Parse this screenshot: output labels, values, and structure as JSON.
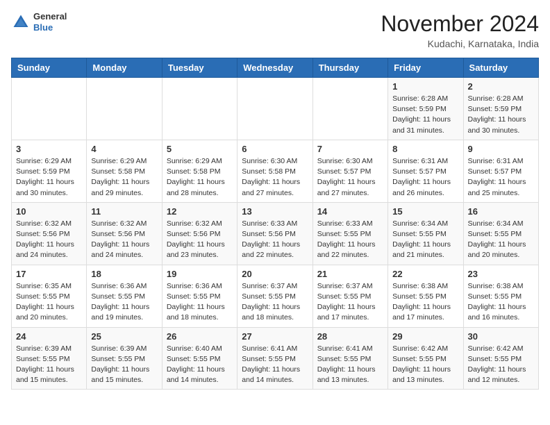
{
  "header": {
    "logo_general": "General",
    "logo_blue": "Blue",
    "month_year": "November 2024",
    "location": "Kudachi, Karnataka, India"
  },
  "calendar": {
    "days_of_week": [
      "Sunday",
      "Monday",
      "Tuesday",
      "Wednesday",
      "Thursday",
      "Friday",
      "Saturday"
    ],
    "weeks": [
      [
        {
          "day": "",
          "info": ""
        },
        {
          "day": "",
          "info": ""
        },
        {
          "day": "",
          "info": ""
        },
        {
          "day": "",
          "info": ""
        },
        {
          "day": "",
          "info": ""
        },
        {
          "day": "1",
          "info": "Sunrise: 6:28 AM\nSunset: 5:59 PM\nDaylight: 11 hours\nand 31 minutes."
        },
        {
          "day": "2",
          "info": "Sunrise: 6:28 AM\nSunset: 5:59 PM\nDaylight: 11 hours\nand 30 minutes."
        }
      ],
      [
        {
          "day": "3",
          "info": "Sunrise: 6:29 AM\nSunset: 5:59 PM\nDaylight: 11 hours\nand 30 minutes."
        },
        {
          "day": "4",
          "info": "Sunrise: 6:29 AM\nSunset: 5:58 PM\nDaylight: 11 hours\nand 29 minutes."
        },
        {
          "day": "5",
          "info": "Sunrise: 6:29 AM\nSunset: 5:58 PM\nDaylight: 11 hours\nand 28 minutes."
        },
        {
          "day": "6",
          "info": "Sunrise: 6:30 AM\nSunset: 5:58 PM\nDaylight: 11 hours\nand 27 minutes."
        },
        {
          "day": "7",
          "info": "Sunrise: 6:30 AM\nSunset: 5:57 PM\nDaylight: 11 hours\nand 27 minutes."
        },
        {
          "day": "8",
          "info": "Sunrise: 6:31 AM\nSunset: 5:57 PM\nDaylight: 11 hours\nand 26 minutes."
        },
        {
          "day": "9",
          "info": "Sunrise: 6:31 AM\nSunset: 5:57 PM\nDaylight: 11 hours\nand 25 minutes."
        }
      ],
      [
        {
          "day": "10",
          "info": "Sunrise: 6:32 AM\nSunset: 5:56 PM\nDaylight: 11 hours\nand 24 minutes."
        },
        {
          "day": "11",
          "info": "Sunrise: 6:32 AM\nSunset: 5:56 PM\nDaylight: 11 hours\nand 24 minutes."
        },
        {
          "day": "12",
          "info": "Sunrise: 6:32 AM\nSunset: 5:56 PM\nDaylight: 11 hours\nand 23 minutes."
        },
        {
          "day": "13",
          "info": "Sunrise: 6:33 AM\nSunset: 5:56 PM\nDaylight: 11 hours\nand 22 minutes."
        },
        {
          "day": "14",
          "info": "Sunrise: 6:33 AM\nSunset: 5:55 PM\nDaylight: 11 hours\nand 22 minutes."
        },
        {
          "day": "15",
          "info": "Sunrise: 6:34 AM\nSunset: 5:55 PM\nDaylight: 11 hours\nand 21 minutes."
        },
        {
          "day": "16",
          "info": "Sunrise: 6:34 AM\nSunset: 5:55 PM\nDaylight: 11 hours\nand 20 minutes."
        }
      ],
      [
        {
          "day": "17",
          "info": "Sunrise: 6:35 AM\nSunset: 5:55 PM\nDaylight: 11 hours\nand 20 minutes."
        },
        {
          "day": "18",
          "info": "Sunrise: 6:36 AM\nSunset: 5:55 PM\nDaylight: 11 hours\nand 19 minutes."
        },
        {
          "day": "19",
          "info": "Sunrise: 6:36 AM\nSunset: 5:55 PM\nDaylight: 11 hours\nand 18 minutes."
        },
        {
          "day": "20",
          "info": "Sunrise: 6:37 AM\nSunset: 5:55 PM\nDaylight: 11 hours\nand 18 minutes."
        },
        {
          "day": "21",
          "info": "Sunrise: 6:37 AM\nSunset: 5:55 PM\nDaylight: 11 hours\nand 17 minutes."
        },
        {
          "day": "22",
          "info": "Sunrise: 6:38 AM\nSunset: 5:55 PM\nDaylight: 11 hours\nand 17 minutes."
        },
        {
          "day": "23",
          "info": "Sunrise: 6:38 AM\nSunset: 5:55 PM\nDaylight: 11 hours\nand 16 minutes."
        }
      ],
      [
        {
          "day": "24",
          "info": "Sunrise: 6:39 AM\nSunset: 5:55 PM\nDaylight: 11 hours\nand 15 minutes."
        },
        {
          "day": "25",
          "info": "Sunrise: 6:39 AM\nSunset: 5:55 PM\nDaylight: 11 hours\nand 15 minutes."
        },
        {
          "day": "26",
          "info": "Sunrise: 6:40 AM\nSunset: 5:55 PM\nDaylight: 11 hours\nand 14 minutes."
        },
        {
          "day": "27",
          "info": "Sunrise: 6:41 AM\nSunset: 5:55 PM\nDaylight: 11 hours\nand 14 minutes."
        },
        {
          "day": "28",
          "info": "Sunrise: 6:41 AM\nSunset: 5:55 PM\nDaylight: 11 hours\nand 13 minutes."
        },
        {
          "day": "29",
          "info": "Sunrise: 6:42 AM\nSunset: 5:55 PM\nDaylight: 11 hours\nand 13 minutes."
        },
        {
          "day": "30",
          "info": "Sunrise: 6:42 AM\nSunset: 5:55 PM\nDaylight: 11 hours\nand 12 minutes."
        }
      ]
    ]
  }
}
